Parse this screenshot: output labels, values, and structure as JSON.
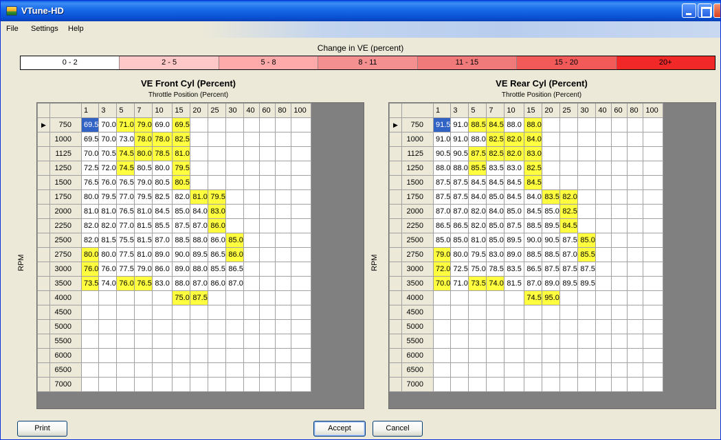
{
  "window": {
    "title": "VTune-HD"
  },
  "menu": {
    "file": "File",
    "settings": "Settings",
    "help": "Help"
  },
  "legend": {
    "caption": "Change in VE (percent)",
    "ranges": [
      {
        "label": "0 - 2",
        "color": "#ffffff"
      },
      {
        "label": "2 - 5",
        "color": "#ffc8c8"
      },
      {
        "label": "5 - 8",
        "color": "#ffaaaa"
      },
      {
        "label": "8 - 11",
        "color": "#f59090"
      },
      {
        "label": "11 - 15",
        "color": "#f07a7a"
      },
      {
        "label": "15 - 20",
        "color": "#f25a5a"
      },
      {
        "label": "20+",
        "color": "#f02828"
      }
    ]
  },
  "throttle_columns": [
    "1",
    "3",
    "5",
    "7",
    "10",
    "15",
    "20",
    "25",
    "30",
    "40",
    "60",
    "80",
    "100"
  ],
  "rpm_rows": [
    "750",
    "1000",
    "1125",
    "1250",
    "1500",
    "1750",
    "2000",
    "2250",
    "2500",
    "2750",
    "3000",
    "3500",
    "4000",
    "4500",
    "5000",
    "5500",
    "6000",
    "6500",
    "7000"
  ],
  "front": {
    "title": "VE Front Cyl (Percent)",
    "subtitle": "Throttle Position (Percent)",
    "axis_label": "RPM",
    "cells": [
      [
        "69.5",
        "70.0",
        "71.0",
        "79.0",
        "69.0",
        "69.5",
        "",
        "",
        "",
        "",
        "",
        "",
        ""
      ],
      [
        "69.5",
        "70.0",
        "73.0",
        "78.0",
        "78.0",
        "82.5",
        "",
        "",
        "",
        "",
        "",
        "",
        ""
      ],
      [
        "70.0",
        "70.5",
        "74.5",
        "80.0",
        "78.5",
        "81.0",
        "",
        "",
        "",
        "",
        "",
        "",
        ""
      ],
      [
        "72.5",
        "72.0",
        "74.5",
        "80.5",
        "80.0",
        "79.5",
        "",
        "",
        "",
        "",
        "",
        "",
        ""
      ],
      [
        "76.5",
        "76.0",
        "76.5",
        "79.0",
        "80.5",
        "80.5",
        "",
        "",
        "",
        "",
        "",
        "",
        ""
      ],
      [
        "80.0",
        "79.5",
        "77.0",
        "79.5",
        "82.5",
        "82.0",
        "81.0",
        "79.5",
        "",
        "",
        "",
        "",
        ""
      ],
      [
        "81.0",
        "81.0",
        "76.5",
        "81.0",
        "84.5",
        "85.0",
        "84.0",
        "83.0",
        "",
        "",
        "",
        "",
        ""
      ],
      [
        "82.0",
        "82.0",
        "77.0",
        "81.5",
        "85.5",
        "87.5",
        "87.0",
        "86.0",
        "",
        "",
        "",
        "",
        ""
      ],
      [
        "82.0",
        "81.5",
        "75.5",
        "81.5",
        "87.0",
        "88.5",
        "88.0",
        "86.0",
        "85.0",
        "",
        "",
        "",
        ""
      ],
      [
        "80.0",
        "80.0",
        "77.5",
        "81.0",
        "89.0",
        "90.0",
        "89.5",
        "86.5",
        "86.0",
        "",
        "",
        "",
        ""
      ],
      [
        "76.0",
        "76.0",
        "77.5",
        "79.0",
        "86.0",
        "89.0",
        "88.0",
        "85.5",
        "86.5",
        "",
        "",
        "",
        ""
      ],
      [
        "73.5",
        "74.0",
        "76.0",
        "76.5",
        "83.0",
        "88.0",
        "87.0",
        "86.0",
        "87.0",
        "",
        "",
        "",
        ""
      ],
      [
        "",
        "",
        "",
        "",
        "",
        "75.0",
        "87.5",
        "",
        "",
        "",
        "",
        "",
        ""
      ],
      [
        "",
        "",
        "",
        "",
        "",
        "",
        "",
        "",
        "",
        "",
        "",
        "",
        ""
      ],
      [
        "",
        "",
        "",
        "",
        "",
        "",
        "",
        "",
        "",
        "",
        "",
        "",
        ""
      ],
      [
        "",
        "",
        "",
        "",
        "",
        "",
        "",
        "",
        "",
        "",
        "",
        "",
        ""
      ],
      [
        "",
        "",
        "",
        "",
        "",
        "",
        "",
        "",
        "",
        "",
        "",
        "",
        ""
      ],
      [
        "",
        "",
        "",
        "",
        "",
        "",
        "",
        "",
        "",
        "",
        "",
        "",
        ""
      ],
      [
        "",
        "",
        "",
        "",
        "",
        "",
        "",
        "",
        "",
        "",
        "",
        "",
        ""
      ]
    ],
    "highlighted": [
      [
        0,
        2
      ],
      [
        0,
        3
      ],
      [
        0,
        5
      ],
      [
        1,
        3
      ],
      [
        1,
        4
      ],
      [
        1,
        5
      ],
      [
        2,
        2
      ],
      [
        2,
        3
      ],
      [
        2,
        4
      ],
      [
        2,
        5
      ],
      [
        3,
        2
      ],
      [
        3,
        5
      ],
      [
        4,
        5
      ],
      [
        5,
        6
      ],
      [
        5,
        7
      ],
      [
        6,
        7
      ],
      [
        7,
        7
      ],
      [
        8,
        8
      ],
      [
        9,
        0
      ],
      [
        9,
        8
      ],
      [
        10,
        0
      ],
      [
        11,
        0
      ],
      [
        11,
        2
      ],
      [
        11,
        3
      ],
      [
        12,
        5
      ],
      [
        12,
        6
      ]
    ],
    "current": [
      0,
      0
    ]
  },
  "rear": {
    "title": "VE Rear Cyl (Percent)",
    "subtitle": "Throttle Position (Percent)",
    "axis_label": "RPM",
    "cells": [
      [
        "91.5",
        "91.0",
        "88.5",
        "84.5",
        "88.0",
        "88.0",
        "",
        "",
        "",
        "",
        "",
        "",
        ""
      ],
      [
        "91.0",
        "91.0",
        "88.0",
        "82.5",
        "82.0",
        "84.0",
        "",
        "",
        "",
        "",
        "",
        "",
        ""
      ],
      [
        "90.5",
        "90.5",
        "87.5",
        "82.5",
        "82.0",
        "83.0",
        "",
        "",
        "",
        "",
        "",
        "",
        ""
      ],
      [
        "88.0",
        "88.0",
        "85.5",
        "83.5",
        "83.0",
        "82.5",
        "",
        "",
        "",
        "",
        "",
        "",
        ""
      ],
      [
        "87.5",
        "87.5",
        "84.5",
        "84.5",
        "84.5",
        "84.5",
        "",
        "",
        "",
        "",
        "",
        "",
        ""
      ],
      [
        "87.5",
        "87.5",
        "84.0",
        "85.0",
        "84.5",
        "84.0",
        "83.5",
        "82.0",
        "",
        "",
        "",
        "",
        ""
      ],
      [
        "87.0",
        "87.0",
        "82.0",
        "84.0",
        "85.0",
        "84.5",
        "85.0",
        "82.5",
        "",
        "",
        "",
        "",
        ""
      ],
      [
        "86.5",
        "86.5",
        "82.0",
        "85.0",
        "87.5",
        "88.5",
        "89.5",
        "84.5",
        "",
        "",
        "",
        "",
        ""
      ],
      [
        "85.0",
        "85.0",
        "81.0",
        "85.0",
        "89.5",
        "90.0",
        "90.5",
        "87.5",
        "85.0",
        "",
        "",
        "",
        ""
      ],
      [
        "79.0",
        "80.0",
        "79.5",
        "83.0",
        "89.0",
        "88.5",
        "88.5",
        "87.0",
        "85.5",
        "",
        "",
        "",
        ""
      ],
      [
        "72.0",
        "72.5",
        "75.0",
        "78.5",
        "83.5",
        "86.5",
        "87.5",
        "87.5",
        "87.5",
        "",
        "",
        "",
        ""
      ],
      [
        "70.0",
        "71.0",
        "73.5",
        "74.0",
        "81.5",
        "87.0",
        "89.0",
        "89.5",
        "89.5",
        "",
        "",
        "",
        ""
      ],
      [
        "",
        "",
        "",
        "",
        "",
        "74.5",
        "95.0",
        "",
        "",
        "",
        "",
        "",
        ""
      ],
      [
        "",
        "",
        "",
        "",
        "",
        "",
        "",
        "",
        "",
        "",
        "",
        "",
        ""
      ],
      [
        "",
        "",
        "",
        "",
        "",
        "",
        "",
        "",
        "",
        "",
        "",
        "",
        ""
      ],
      [
        "",
        "",
        "",
        "",
        "",
        "",
        "",
        "",
        "",
        "",
        "",
        "",
        ""
      ],
      [
        "",
        "",
        "",
        "",
        "",
        "",
        "",
        "",
        "",
        "",
        "",
        "",
        ""
      ],
      [
        "",
        "",
        "",
        "",
        "",
        "",
        "",
        "",
        "",
        "",
        "",
        "",
        ""
      ],
      [
        "",
        "",
        "",
        "",
        "",
        "",
        "",
        "",
        "",
        "",
        "",
        "",
        ""
      ]
    ],
    "highlighted": [
      [
        0,
        2
      ],
      [
        0,
        3
      ],
      [
        0,
        5
      ],
      [
        1,
        3
      ],
      [
        1,
        4
      ],
      [
        1,
        5
      ],
      [
        2,
        2
      ],
      [
        2,
        3
      ],
      [
        2,
        4
      ],
      [
        2,
        5
      ],
      [
        3,
        2
      ],
      [
        3,
        5
      ],
      [
        4,
        5
      ],
      [
        5,
        6
      ],
      [
        5,
        7
      ],
      [
        6,
        7
      ],
      [
        7,
        7
      ],
      [
        8,
        8
      ],
      [
        9,
        0
      ],
      [
        9,
        8
      ],
      [
        10,
        0
      ],
      [
        11,
        0
      ],
      [
        11,
        2
      ],
      [
        11,
        3
      ],
      [
        12,
        5
      ],
      [
        12,
        6
      ]
    ],
    "current": [
      0,
      0
    ]
  },
  "buttons": {
    "print": "Print",
    "accept": "Accept",
    "cancel": "Cancel"
  },
  "colors": {
    "highlight": "#ffff40",
    "selected_cell": "#3163c5",
    "titlebar": "#0a52d6"
  },
  "icons": {
    "app": "app-icon",
    "minimize": "minimize-icon",
    "maximize": "maximize-icon",
    "close": "close-icon",
    "row_pointer": "triangle-right-icon"
  }
}
